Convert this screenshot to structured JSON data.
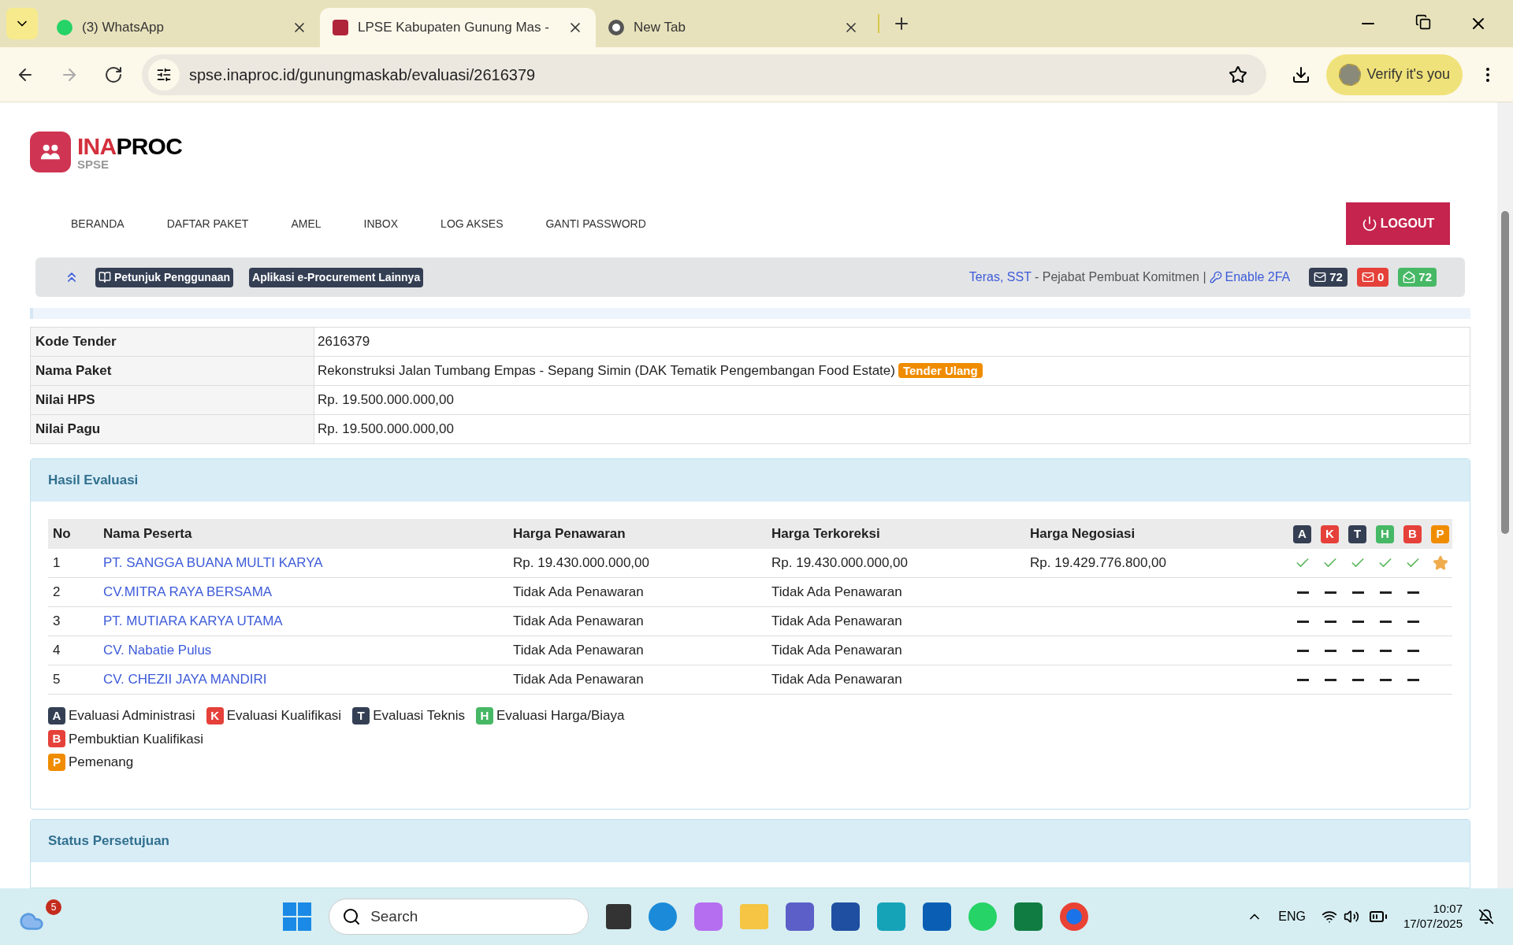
{
  "browser": {
    "tabs": [
      {
        "title": "(3) WhatsApp",
        "selected": false
      },
      {
        "title": "LPSE Kabupaten Gunung Mas -",
        "selected": true
      },
      {
        "title": "New Tab",
        "selected": false
      }
    ],
    "url": "spse.inaproc.id/gunungmaskab/evaluasi/2616379",
    "profile_button": "Verify it's you"
  },
  "logo": {
    "brand_part1": "INA",
    "brand_part2": "PROC",
    "sub": "SPSE"
  },
  "nav": [
    "BERANDA",
    "DAFTAR PAKET",
    "AMEL",
    "INBOX",
    "LOG AKSES",
    "GANTI PASSWORD"
  ],
  "logout": "LOGOUT",
  "infobar": {
    "buttons": [
      "Petunjuk Penggunaan",
      "Aplikasi e-Procurement Lainnya"
    ],
    "user_link": "Teras, SST",
    "role": "- Pejabat Pembuat Komitmen |",
    "twofa": "Enable 2FA",
    "badges": [
      {
        "count": "72",
        "color": "#343f54"
      },
      {
        "count": "0",
        "color": "#e5413a"
      },
      {
        "count": "72",
        "color": "#47b865"
      }
    ]
  },
  "details": [
    {
      "label": "Kode Tender",
      "value": "2616379"
    },
    {
      "label": "Nama Paket",
      "value": "Rekonstruksi Jalan Tumbang Empas - Sepang Simin (DAK Tematik Pengembangan Food Estate)",
      "tag": "Tender Ulang"
    },
    {
      "label": "Nilai HPS",
      "value": "Rp. 19.500.000.000,00"
    },
    {
      "label": "Nilai Pagu",
      "value": "Rp. 19.500.000.000,00"
    }
  ],
  "hasil_evaluasi": {
    "title": "Hasil Evaluasi",
    "columns": [
      "No",
      "Nama Peserta",
      "Harga Penawaran",
      "Harga Terkoreksi",
      "Harga Negosiasi"
    ],
    "stages": [
      {
        "letter": "A",
        "color": "#343f54"
      },
      {
        "letter": "K",
        "color": "#e5413a"
      },
      {
        "letter": "T",
        "color": "#343f54"
      },
      {
        "letter": "H",
        "color": "#47b865"
      },
      {
        "letter": "B",
        "color": "#e5413a"
      },
      {
        "letter": "P",
        "color": "#f08c00"
      }
    ],
    "rows": [
      {
        "no": "1",
        "name": "PT. SANGGA BUANA MULTI KARYA",
        "penawaran": "Rp. 19.430.000.000,00",
        "terkoreksi": "Rp. 19.430.000.000,00",
        "negosiasi": "Rp. 19.429.776.800,00",
        "passed": [
          true,
          true,
          true,
          true,
          true
        ],
        "winner": true
      },
      {
        "no": "2",
        "name": "CV.MITRA RAYA BERSAMA",
        "penawaran": "Tidak Ada Penawaran",
        "terkoreksi": "Tidak Ada Penawaran",
        "passed": [
          false,
          false,
          false,
          false,
          false
        ],
        "winner": false
      },
      {
        "no": "3",
        "name": "PT. MUTIARA KARYA UTAMA",
        "penawaran": "Tidak Ada Penawaran",
        "terkoreksi": "Tidak Ada Penawaran",
        "passed": [
          false,
          false,
          false,
          false,
          false
        ],
        "winner": false
      },
      {
        "no": "4",
        "name": "CV. Nabatie Pulus",
        "penawaran": "Tidak Ada Penawaran",
        "terkoreksi": "Tidak Ada Penawaran",
        "passed": [
          false,
          false,
          false,
          false,
          false
        ],
        "winner": false
      },
      {
        "no": "5",
        "name": "CV. CHEZII JAYA MANDIRI",
        "penawaran": "Tidak Ada Penawaran",
        "terkoreksi": "Tidak Ada Penawaran",
        "passed": [
          false,
          false,
          false,
          false,
          false
        ],
        "winner": false
      }
    ],
    "legend": [
      {
        "letter": "A",
        "color": "#343f54",
        "label": "Evaluasi Administrasi"
      },
      {
        "letter": "K",
        "color": "#e5413a",
        "label": "Evaluasi Kualifikasi"
      },
      {
        "letter": "T",
        "color": "#343f54",
        "label": "Evaluasi Teknis"
      },
      {
        "letter": "H",
        "color": "#47b865",
        "label": "Evaluasi Harga/Biaya"
      },
      {
        "letter": "B",
        "color": "#e5413a",
        "label": "Pembuktian Kualifikasi"
      },
      {
        "letter": "P",
        "color": "#f08c00",
        "label": "Pemenang"
      }
    ]
  },
  "status_persetujuan": {
    "title": "Status Persetujuan"
  },
  "taskbar": {
    "weather_badge": "5",
    "search": "Search",
    "lang": "ENG",
    "time": "10:07",
    "date": "17/07/2025"
  }
}
